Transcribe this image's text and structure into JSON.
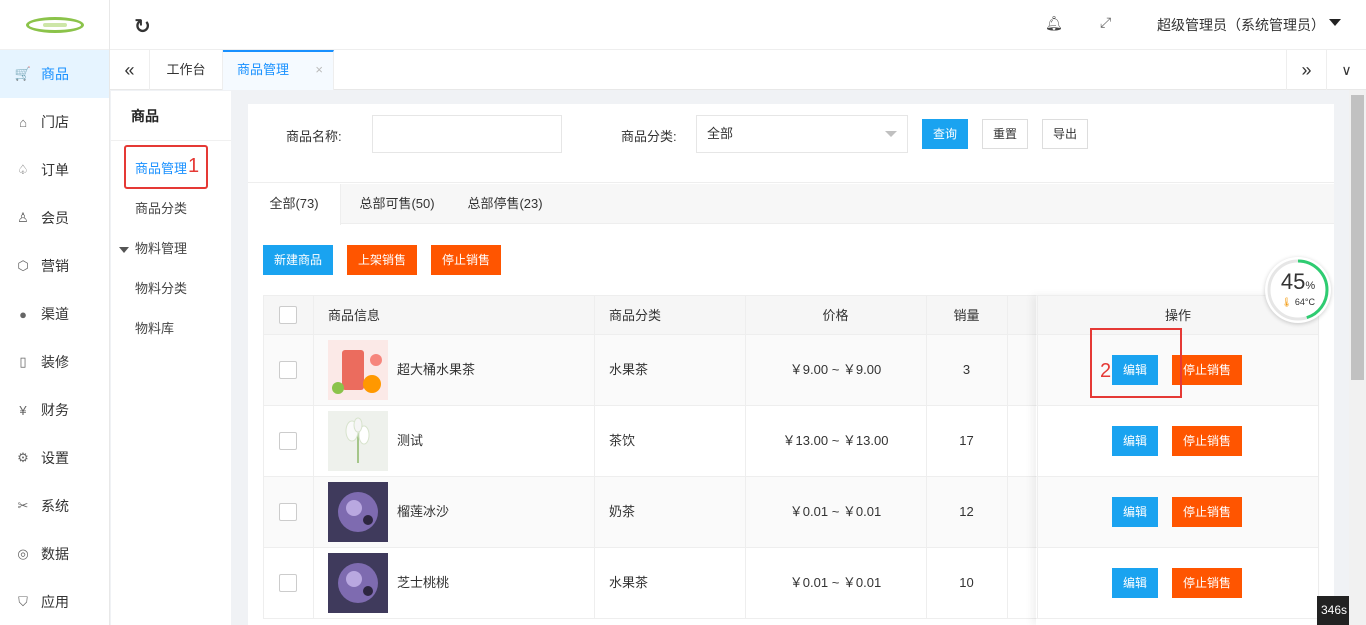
{
  "sidebar": {
    "items": [
      {
        "label": "商品",
        "icon": "cart-icon",
        "active": true
      },
      {
        "label": "门店",
        "icon": "home-icon"
      },
      {
        "label": "订单",
        "icon": "bell-icon"
      },
      {
        "label": "会员",
        "icon": "user-icon"
      },
      {
        "label": "营销",
        "icon": "box-icon"
      },
      {
        "label": "渠道",
        "icon": "channel-icon"
      },
      {
        "label": "装修",
        "icon": "tablet-icon"
      },
      {
        "label": "财务",
        "icon": "yen-icon"
      },
      {
        "label": "设置",
        "icon": "gear-icon"
      },
      {
        "label": "系统",
        "icon": "tools-icon"
      },
      {
        "label": "数据",
        "icon": "globe-icon"
      },
      {
        "label": "应用",
        "icon": "shield-icon"
      }
    ]
  },
  "header": {
    "user": "超级管理员（系统管理员）"
  },
  "tabs": {
    "work": "工作台",
    "goods": "商品管理",
    "close": "×"
  },
  "submenu": {
    "title": "商品",
    "items": [
      "商品管理",
      "商品分类",
      "物料管理",
      "物料分类",
      "物料库"
    ]
  },
  "annotations": {
    "n1": "1",
    "n2": "2"
  },
  "filter": {
    "name_label": "商品名称:",
    "category_label": "商品分类:",
    "category_value": "全部",
    "query": "查询",
    "reset": "重置",
    "export": "导出"
  },
  "status_tabs": [
    "全部(73)",
    "总部可售(50)",
    "总部停售(23)"
  ],
  "actions": {
    "new": "新建商品",
    "on_sale": "上架销售",
    "stop_sale": "停止销售"
  },
  "table": {
    "headers": {
      "info": "商品信息",
      "category": "商品分类",
      "price": "价格",
      "sales": "销量",
      "ops": "操作"
    },
    "rows": [
      {
        "name": "超大桶水果茶",
        "category": "水果茶",
        "price": "￥9.00 ~ ￥9.00",
        "sales": "3",
        "edit": "编辑",
        "stop": "停止销售"
      },
      {
        "name": "测试",
        "category": "茶饮",
        "price": "￥13.00 ~ ￥13.00",
        "sales": "17",
        "edit": "编辑",
        "stop": "停止销售"
      },
      {
        "name": "榴莲冰沙",
        "category": "奶茶",
        "price": "￥0.01 ~ ￥0.01",
        "sales": "12",
        "edit": "编辑",
        "stop": "停止销售"
      },
      {
        "name": "芝士桃桃",
        "category": "水果茶",
        "price": "￥0.01 ~ ￥0.01",
        "sales": "10",
        "edit": "编辑",
        "stop": "停止销售"
      }
    ]
  },
  "widget": {
    "value": "45",
    "unit": "%",
    "temp": "64°C"
  },
  "timer": "346s"
}
